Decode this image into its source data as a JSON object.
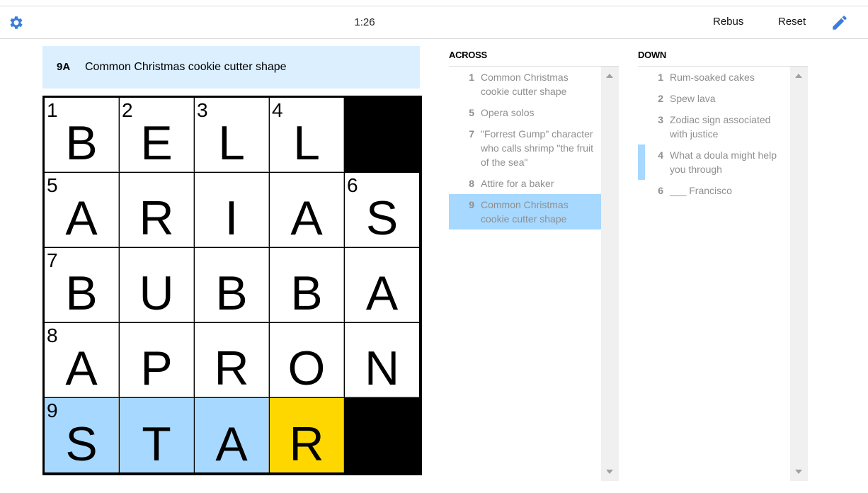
{
  "toolbar": {
    "timer": "1:26",
    "rebus_label": "Rebus",
    "reset_label": "Reset",
    "settings_icon": "gear-icon",
    "pencil_icon": "pencil-icon",
    "accent": "#3b7ddd"
  },
  "current_clue": {
    "label": "9A",
    "text": "Common Christmas cookie cutter shape"
  },
  "colors": {
    "highlight": "#a7d8ff",
    "selected": "#ffd700",
    "clue_bar": "#dcefff"
  },
  "grid": {
    "rows": [
      [
        {
          "n": "1",
          "l": "B"
        },
        {
          "n": "2",
          "l": "E"
        },
        {
          "n": "3",
          "l": "L"
        },
        {
          "n": "4",
          "l": "L"
        },
        {
          "black": true
        }
      ],
      [
        {
          "n": "5",
          "l": "A"
        },
        {
          "n": "",
          "l": "R"
        },
        {
          "n": "",
          "l": "I"
        },
        {
          "n": "",
          "l": "A"
        },
        {
          "n": "6",
          "l": "S"
        }
      ],
      [
        {
          "n": "7",
          "l": "B"
        },
        {
          "n": "",
          "l": "U"
        },
        {
          "n": "",
          "l": "B"
        },
        {
          "n": "",
          "l": "B"
        },
        {
          "n": "",
          "l": "A"
        }
      ],
      [
        {
          "n": "8",
          "l": "A"
        },
        {
          "n": "",
          "l": "P"
        },
        {
          "n": "",
          "l": "R"
        },
        {
          "n": "",
          "l": "O"
        },
        {
          "n": "",
          "l": "N"
        }
      ],
      [
        {
          "n": "9",
          "l": "S",
          "state": "hl"
        },
        {
          "n": "",
          "l": "T",
          "state": "hl"
        },
        {
          "n": "",
          "l": "A",
          "state": "hl"
        },
        {
          "n": "",
          "l": "R",
          "state": "sel"
        },
        {
          "black": true
        }
      ]
    ]
  },
  "across": {
    "title": "ACROSS",
    "clues": [
      {
        "num": "1",
        "text": "Common Christmas cookie cutter shape"
      },
      {
        "num": "5",
        "text": "Opera solos"
      },
      {
        "num": "7",
        "text": "\"Forrest Gump\" character who calls shrimp \"the fruit of the sea\""
      },
      {
        "num": "8",
        "text": "Attire for a baker"
      },
      {
        "num": "9",
        "text": "Common Christmas cookie cutter shape",
        "active": true
      }
    ]
  },
  "down": {
    "title": "DOWN",
    "clues": [
      {
        "num": "1",
        "text": "Rum-soaked cakes"
      },
      {
        "num": "2",
        "text": "Spew lava"
      },
      {
        "num": "3",
        "text": "Zodiac sign associated with justice"
      },
      {
        "num": "4",
        "text": "What a doula might help you through",
        "cross": true
      },
      {
        "num": "6",
        "text": "___ Francisco"
      }
    ]
  }
}
